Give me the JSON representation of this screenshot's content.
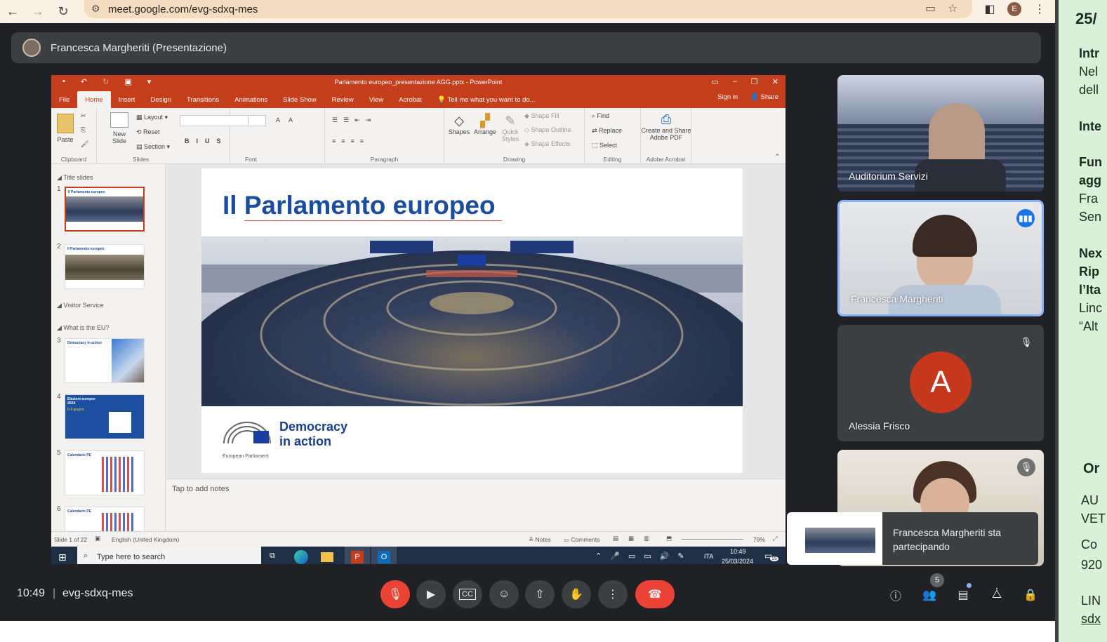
{
  "browser": {
    "url": "meet.google.com/evg-sdxq-mes",
    "profile_initial": "E"
  },
  "presenter_bar": {
    "label": "Francesca Margheriti (Presentazione)"
  },
  "powerpoint": {
    "window_title": "Parlamento europeo_presentazione AGG.pptx - PowerPoint",
    "tabs": [
      "File",
      "Home",
      "Insert",
      "Design",
      "Transitions",
      "Animations",
      "Slide Show",
      "Review",
      "View",
      "Acrobat"
    ],
    "active_tab": "Home",
    "tell_me": "Tell me what you want to do...",
    "sign_in": "Sign in",
    "share": "Share",
    "ribbon": {
      "paste": "Paste",
      "new_slide": "New Slide",
      "layout": "Layout",
      "reset": "Reset",
      "section": "Section",
      "shapes": "Shapes",
      "arrange": "Arrange",
      "quick_styles": "Quick Styles",
      "shape_fill": "Shape Fill",
      "shape_outline": "Shape Outline",
      "shape_effects": "Shape Effects",
      "find": "Find",
      "replace": "Replace",
      "select": "Select",
      "create_share": "Create and Share Adobe PDF",
      "groups": {
        "clipboard": "Clipboard",
        "slides": "Slides",
        "font": "Font",
        "paragraph": "Paragraph",
        "drawing": "Drawing",
        "editing": "Editing",
        "adobe": "Adobe Acrobat"
      }
    },
    "sections": {
      "title_slides": "Title slides",
      "visitor_service": "Visitor Service",
      "what_is_eu": "What is the EU?"
    },
    "thumb_texts": {
      "t1": "Il Parlamento europeo",
      "t2": "Il Parlamento europeo",
      "t3": "Democracy in action",
      "t4": "Elezioni europee 2024",
      "t4b": "6-9 giugno",
      "t5": "Calendario PE",
      "t6": "Calendario PE"
    },
    "slide": {
      "title": "Il Parlamento europeo",
      "logo_line1": "Democracy",
      "logo_line2": "in action",
      "logo_caption": "European Parliament"
    },
    "notes_placeholder": "Tap to add notes",
    "status": {
      "slide_of": "Slide 1 of 22",
      "language": "English (United Kingdom)",
      "notes": "Notes",
      "comments": "Comments",
      "zoom": "79%"
    },
    "taskbar": {
      "search_placeholder": "Type here to search",
      "lang": "ITA",
      "time": "10:49",
      "date": "25/03/2024",
      "notif": "15"
    }
  },
  "participants": [
    {
      "name": "Auditorium Servizi"
    },
    {
      "name": "Francesca Margheriti"
    },
    {
      "name": "Alessia Frisco",
      "initial": "A"
    },
    {
      "name": ""
    }
  ],
  "toast": {
    "text_line1": "Francesca Margheriti sta",
    "text_line2": "partecipando"
  },
  "controls": {
    "time": "10:49",
    "separator": "|",
    "meeting_code": "evg-sdxq-mes",
    "people_count": "5"
  },
  "side_doc": {
    "l1": "25/",
    "l2": "Intr",
    "l3": "Nel",
    "l4": "dell",
    "l5": "Inte",
    "l6": "Fun",
    "l7": "agg",
    "l8": "Fra",
    "l9": "Sen",
    "l10": "Nex",
    "l11": "Rip",
    "l12": "l’Ita",
    "l13": "Linc",
    "l14": "“Alt",
    "l15": "Or",
    "l16": "AU",
    "l17": "VET",
    "l18": "Co",
    "l19": "920",
    "l20": "LIN",
    "l21": "sdx"
  },
  "colors": {
    "meet_bg": "#202124",
    "end_call": "#ea4335",
    "ppt_accent": "#c43e1c",
    "slide_title": "#1a4d9e",
    "speaking_border": "#8ab4f8",
    "avatar_bg": "#c5381d",
    "side_doc_bg": "#d9f1d8"
  }
}
